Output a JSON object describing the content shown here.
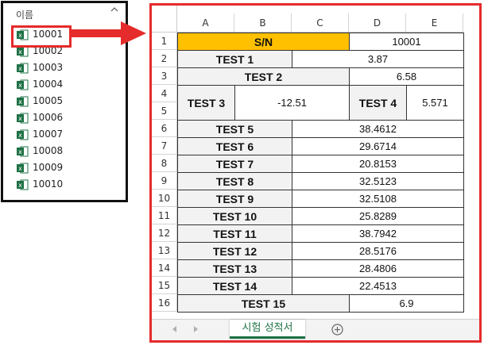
{
  "explorer": {
    "header": "이름",
    "files": [
      "10001",
      "10002",
      "10003",
      "10004",
      "10005",
      "10006",
      "10007",
      "10008",
      "10009",
      "10010"
    ],
    "selected_index": 0
  },
  "sheet": {
    "columns": [
      "A",
      "B",
      "C",
      "D",
      "E"
    ],
    "rows": [
      "1",
      "2",
      "3",
      "4",
      "5",
      "6",
      "7",
      "8",
      "9",
      "10",
      "11",
      "12",
      "13",
      "14",
      "15",
      "16"
    ],
    "cells": {
      "sn_label": "S/N",
      "sn_value": "10001",
      "test1_label": "TEST 1",
      "test1_value": "3.87",
      "test2_label": "TEST 2",
      "test2_value": "6.58",
      "test3_label": "TEST 3",
      "test3_value": "-12.51",
      "test4_label": "TEST 4",
      "test4_value": "5.571",
      "test5_label": "TEST 5",
      "test5_value": "38.4612",
      "test6_label": "TEST 6",
      "test6_value": "29.6714",
      "test7_label": "TEST 7",
      "test7_value": "20.8153",
      "test8_label": "TEST 8",
      "test8_value": "32.5123",
      "test9_label": "TEST 9",
      "test9_value": "32.5108",
      "test10_label": "TEST 10",
      "test10_value": "25.8289",
      "test11_label": "TEST 11",
      "test11_value": "38.7942",
      "test12_label": "TEST 12",
      "test12_value": "28.5176",
      "test13_label": "TEST 13",
      "test13_value": "28.4806",
      "test14_label": "TEST 14",
      "test14_value": "22.4513",
      "test15_label": "TEST 15",
      "test15_value": "6.9"
    },
    "tab_label": "시험 성적서"
  },
  "colors": {
    "highlight": "#e52b2b",
    "sn_fill": "#ffc000",
    "excel_green": "#1e7145"
  }
}
